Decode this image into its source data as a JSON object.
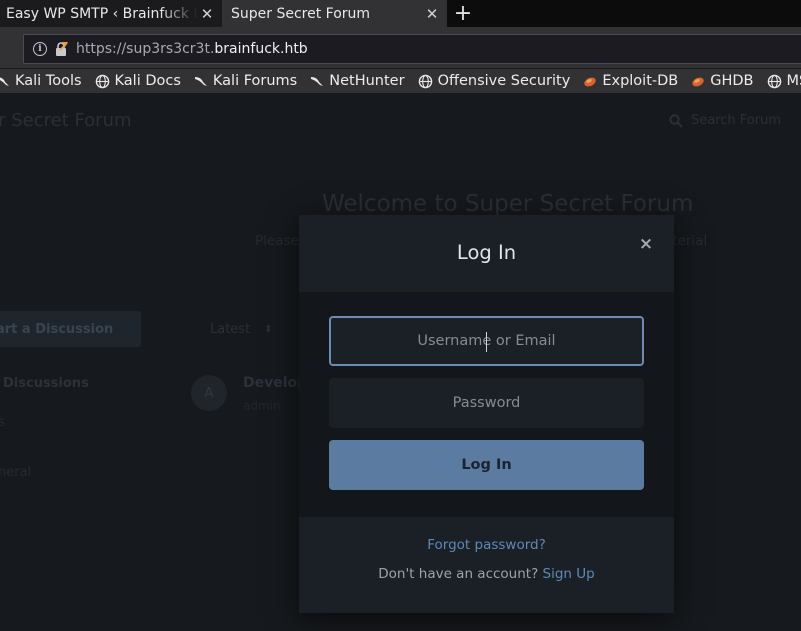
{
  "browser": {
    "tabs": [
      {
        "title": "Easy WP SMTP ‹ Brainfuck L",
        "active": false
      },
      {
        "title": "Super Secret Forum",
        "active": true
      }
    ],
    "url_prefix": "https://sup3rs3cr3t.",
    "url_host": "brainfuck.htb",
    "bookmarks": [
      {
        "label": "Kali Tools",
        "icon": "kali-dragon-icon"
      },
      {
        "label": "Kali Docs",
        "icon": "globe-icon"
      },
      {
        "label": "Kali Forums",
        "icon": "kali-dragon-icon"
      },
      {
        "label": "NetHunter",
        "icon": "kali-dragon-icon"
      },
      {
        "label": "Offensive Security",
        "icon": "globe-icon"
      },
      {
        "label": "Exploit-DB",
        "icon": "exploit-db-bug-icon"
      },
      {
        "label": "GHDB",
        "icon": "exploit-db-bug-icon"
      },
      {
        "label": "MSFU",
        "icon": "globe-icon"
      }
    ]
  },
  "forum": {
    "brand": "er Secret Forum",
    "search_placeholder": "Search Forum",
    "hero_title": "Welcome to Super Secret Forum",
    "hero_subtitle_left": "Please",
    "hero_subtitle_right": "aterial",
    "start_discussion": "art a Discussion",
    "all_discussions": "Discussions",
    "tags": "s",
    "general": "neral",
    "sort": "Latest",
    "discussion": {
      "avatar": "A",
      "title": "Develop",
      "meta": "admin"
    }
  },
  "modal": {
    "title": "Log In",
    "close_glyph": "×",
    "username_placeholder": "Username or Email",
    "password_placeholder": "Password",
    "submit_label": "Log In",
    "forgot_label": "Forgot password?",
    "signup_prompt": "Don't have an account?",
    "signup_label": "Sign Up"
  },
  "colors": {
    "accent": "#5b7ba1",
    "link": "#5e89b8",
    "modal_bg": "#1b1f26"
  }
}
